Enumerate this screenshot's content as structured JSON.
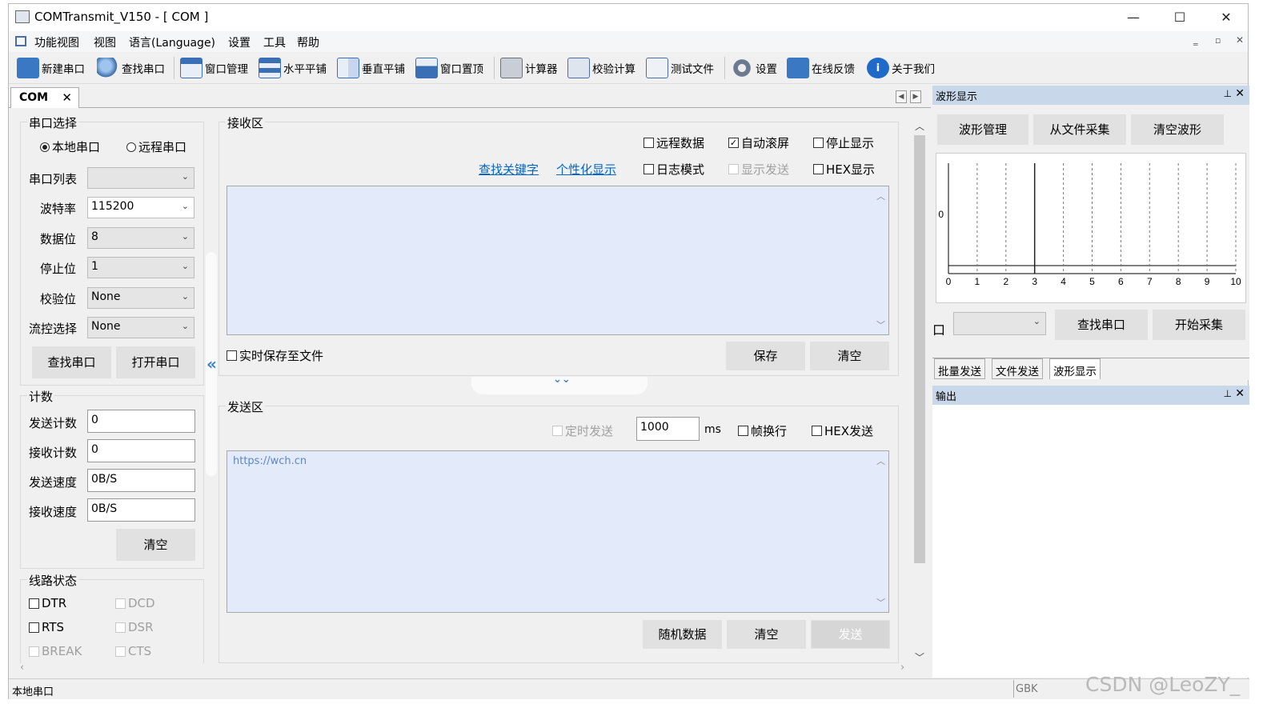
{
  "window": {
    "title": "COMTransmit_V150 - [  COM  ]",
    "minimize": "—",
    "maximize": "☐",
    "close": "✕"
  },
  "menu": {
    "items": [
      "功能视图",
      "视图",
      "语言(Language)",
      "设置",
      "工具",
      "帮助"
    ]
  },
  "toolbar": {
    "items": [
      "新建串口",
      "查找串口",
      "窗口管理",
      "水平平铺",
      "垂直平铺",
      "窗口置顶",
      "计算器",
      "校验计算",
      "测试文件",
      "设置",
      "在线反馈",
      "关于我们"
    ]
  },
  "tab": {
    "label": "COM",
    "close": "✕"
  },
  "serial": {
    "title": "串口选择",
    "local": "本地串口",
    "remote": "远程串口",
    "port_list_label": "串口列表",
    "port_list_value": "",
    "baud_label": "波特率",
    "baud_value": "115200",
    "databits_label": "数据位",
    "databits_value": "8",
    "stopbits_label": "停止位",
    "stopbits_value": "1",
    "parity_label": "校验位",
    "parity_value": "None",
    "flow_label": "流控选择",
    "flow_value": "None",
    "find_btn": "查找串口",
    "open_btn": "打开串口"
  },
  "count": {
    "title": "计数",
    "send_count_label": "发送计数",
    "send_count": "0",
    "recv_count_label": "接收计数",
    "recv_count": "0",
    "send_speed_label": "发送速度",
    "send_speed": "0B/S",
    "recv_speed_label": "接收速度",
    "recv_speed": "0B/S",
    "clear_btn": "清空"
  },
  "line": {
    "title": "线路状态",
    "dtr": "DTR",
    "dcd": "DCD",
    "rts": "RTS",
    "dsr": "DSR",
    "break": "BREAK",
    "cts": "CTS"
  },
  "collapse_left": "«",
  "receive": {
    "title": "接收区",
    "remote_data": "远程数据",
    "auto_scroll": "自动滚屏",
    "stop_display": "停止显示",
    "find_keyword": "查找关键字",
    "custom_display": "个性化显示",
    "log_mode": "日志模式",
    "show_send": "显示发送",
    "hex_display": "HEX显示",
    "save_realtime": "实时保存至文件",
    "save_btn": "保存",
    "clear_btn": "清空"
  },
  "collapse_down": "⌄⌄",
  "send": {
    "title": "发送区",
    "timed_send": "定时发送",
    "interval": "1000",
    "unit": "ms",
    "frame_newline": "帧换行",
    "hex_send": "HEX发送",
    "content": "https://wch.cn",
    "random_btn": "随机数据",
    "clear_btn": "清空",
    "send_btn": "发送"
  },
  "wave": {
    "panel_title": "波形显示",
    "manage_btn": "波形管理",
    "from_file_btn": "从文件采集",
    "clear_btn": "清空波形",
    "port_label": "口",
    "find_btn": "查找串口",
    "start_btn": "开始采集",
    "y_tick": "0",
    "x_ticks": [
      "0",
      "1",
      "2",
      "3",
      "4",
      "5",
      "6",
      "7",
      "8",
      "9",
      "10"
    ]
  },
  "chart_data": {
    "type": "line",
    "title": "",
    "xlabel": "",
    "ylabel": "",
    "xlim": [
      0,
      10
    ],
    "x_ticks": [
      0,
      1,
      2,
      3,
      4,
      5,
      6,
      7,
      8,
      9,
      10
    ],
    "y_ticks": [
      0
    ],
    "series": [],
    "grid": "vertical dashed",
    "cursor_x": 3
  },
  "right_tabs": [
    "批量发送",
    "文件发送",
    "波形显示"
  ],
  "output": {
    "title": "输出"
  },
  "status": {
    "left": "本地串口",
    "encoding": "GBK"
  },
  "watermark": "CSDN @LeoZY_",
  "colors": {
    "text_area": "#e3ebfb",
    "dock_header": "#c9d7ea",
    "link": "#0066cc"
  }
}
